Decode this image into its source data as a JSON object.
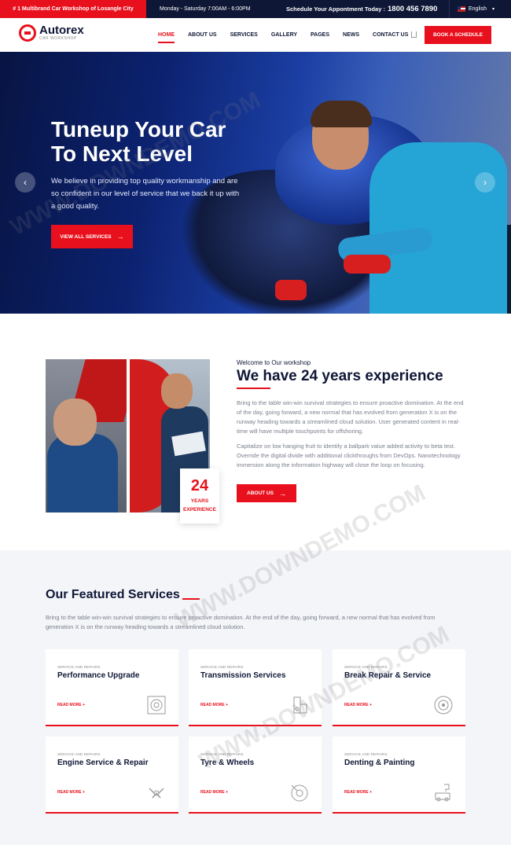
{
  "topbar": {
    "promo": "# 1 Multibrand Car Workshop of Losangle City",
    "hours": "Monday - Saturday 7:00AM - 6:00PM",
    "schedule_label": "Schedule Your Appontment Today :",
    "phone": "1800 456 7890",
    "language": "English"
  },
  "header": {
    "logo_name": "Autorex",
    "logo_tagline": "CAR WORKSHOP",
    "nav": [
      "HOME",
      "ABOUT US",
      "SERVICES",
      "GALLERY",
      "PAGES",
      "NEWS",
      "CONTACT US"
    ],
    "cta": "BOOK A SCHEDULE"
  },
  "hero": {
    "title_line1": "Tuneup Your Car",
    "title_line2": "To Next Level",
    "text": "We believe in providing top quality workmanship and are so confident in our level of service that we back it up with a good quality.",
    "button": "VIEW ALL SERVICES"
  },
  "about": {
    "kicker": "Welcome to Our workshop",
    "title": "We have 24 years experience",
    "paragraph1": "Bring to the table win-win survival strategies to ensure proactive domination. At the end of the day, going forward, a new normal that has evolved from generation X is on the runway heading towards a streamlined cloud solution. User generated content in real-time will have multiple touchpoints for offshoring.",
    "paragraph2": "Capitalize on low hanging fruit to identify a ballpark value added activity to beta test. Override the digital divide with additional clickthroughs from DevOps. Nanotechnology immersion along the information highway will close the loop on focusing.",
    "button": "ABOUT US",
    "badge_number": "24",
    "badge_line1": "YEARS",
    "badge_line2": "EXPERIENCE"
  },
  "services": {
    "title": "Our Featured Services",
    "description": "Bring to the table win-win survival strategies to ensure proactive domination. At the end of the day, going forward, a new normal that has evolved from generation X is on the runway heading towards a streamlined cloud solution.",
    "cards": [
      {
        "kicker": "SERVICE AND REPAIRS",
        "title": "Performance Upgrade",
        "link": "READ MORE +",
        "icon": "turbo-icon"
      },
      {
        "kicker": "SERVICE AND REPAIRS",
        "title": "Transmission Services",
        "link": "READ MORE +",
        "icon": "transmission-icon"
      },
      {
        "kicker": "SERVICE AND REPAIRS",
        "title": "Break Repair & Service",
        "link": "READ MORE +",
        "icon": "brake-disc-icon"
      },
      {
        "kicker": "SERVICE AND REPAIRS",
        "title": "Engine Service & Repair",
        "link": "READ MORE +",
        "icon": "engine-icon"
      },
      {
        "kicker": "SERVICE AND REPAIRS",
        "title": "Tyre & Wheels",
        "link": "READ MORE +",
        "icon": "tyre-icon"
      },
      {
        "kicker": "SERVICE AND REPAIRS",
        "title": "Denting & Painting",
        "link": "READ MORE +",
        "icon": "paint-gun-icon"
      }
    ]
  },
  "watermark": "WWW.DOWNDEMO.COM",
  "colors": {
    "accent": "#e8101c",
    "navy": "#0f1736",
    "section_bg": "#f4f5f8"
  }
}
